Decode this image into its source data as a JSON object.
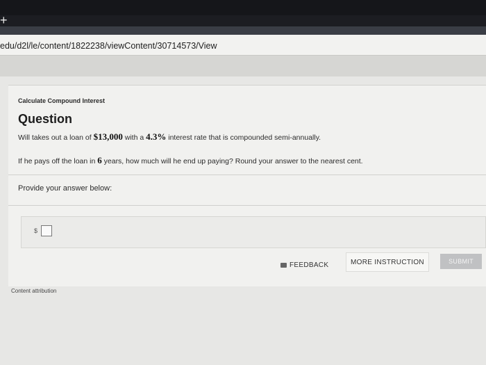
{
  "browser": {
    "url": "edu/d2l/le/content/1822238/viewContent/30714573/View",
    "new_tab_glyph": "+"
  },
  "content": {
    "subtitle": "Calculate Compound Interest",
    "title": "Question",
    "line1": {
      "pre": "Will takes out a loan of ",
      "amount": "$13,000",
      "mid": " with a ",
      "rate": "4.3%",
      "post": " interest rate that is compounded semi-annually."
    },
    "line2": {
      "pre": "If he pays off the loan in ",
      "years": "6",
      "post": " years, how much will he end up paying? Round your answer to the nearest cent."
    },
    "provide": "Provide your answer below:",
    "currency_symbol": "$",
    "answer_value": ""
  },
  "actions": {
    "feedback": "FEEDBACK",
    "more_instruction": "MORE INSTRUCTION",
    "submit": "SUBMIT"
  },
  "footer": {
    "attribution": "Content attribution"
  },
  "icons": {
    "feedback": "feedback-icon",
    "new_tab": "plus-icon"
  }
}
